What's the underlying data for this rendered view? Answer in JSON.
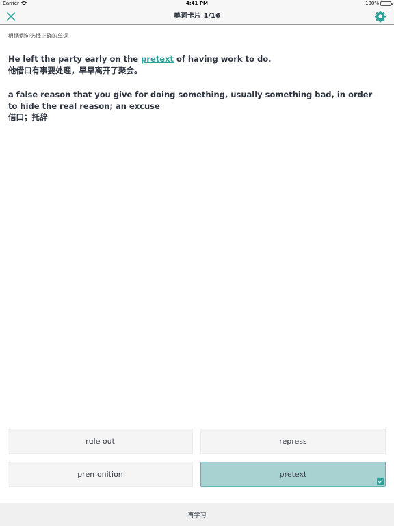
{
  "status_bar": {
    "carrier": "Carrier",
    "time": "4:41 PM",
    "battery": "100%"
  },
  "nav": {
    "title": "单词卡片 1/16",
    "close_icon": "close-icon",
    "settings_icon": "gear-icon"
  },
  "card": {
    "instruction": "根据例句选择正确的单词",
    "example_en_before": "He left the party early on the ",
    "example_en_answer": "pretext",
    "example_en_after": " of having work to do.",
    "example_zh": "他借口有事要处理，早早离开了聚会。",
    "definition_en": "a false reason that you give for doing something, usually something bad, in order to hide the real reason; an excuse",
    "definition_zh": "借口；托辞"
  },
  "options": [
    {
      "label": "rule out",
      "selected": false
    },
    {
      "label": "repress",
      "selected": false
    },
    {
      "label": "premonition",
      "selected": false
    },
    {
      "label": "pretext",
      "selected": true
    }
  ],
  "bottom": {
    "relearn_label": "再学习"
  },
  "colors": {
    "accent": "#2aa198",
    "selected_bg": "#a8d2d2",
    "text": "#2d3440"
  }
}
